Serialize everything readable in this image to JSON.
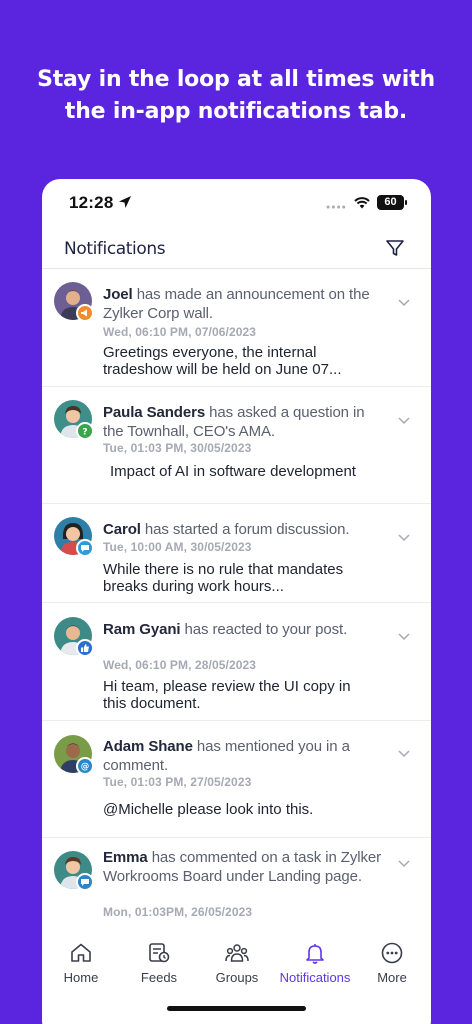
{
  "headline": {
    "line1": "Stay in the loop at all times with",
    "line2": "the in-app notifications tab."
  },
  "status_bar": {
    "time": "12:28",
    "battery": "60"
  },
  "header": {
    "title": "Notifications"
  },
  "notifications": [
    {
      "name": "Joel",
      "action": " has made an announcement on the Zylker Corp wall.",
      "timestamp": "Wed, 06:10 PM, 07/06/2023",
      "message": "Greetings everyone, the internal tradeshow will be held on June 07...",
      "badge_icon": "megaphone-icon",
      "badge_color": "#f08c2c"
    },
    {
      "name": "Paula Sanders",
      "action": " has asked a question in the Townhall, CEO's AMA.",
      "timestamp": "Tue, 01:03 PM, 30/05/2023",
      "message": "Impact of AI in software development",
      "badge_icon": "question-icon",
      "badge_color": "#3aa54a"
    },
    {
      "name": "Carol",
      "action": " has started a forum discussion.",
      "timestamp": "Tue, 10:00 AM, 30/05/2023",
      "message": "While there is no rule that mandates breaks during work hours...",
      "badge_icon": "chat-icon",
      "badge_color": "#2e9bd6"
    },
    {
      "name": "Ram Gyani",
      "action": " has reacted to your post.",
      "timestamp": "Wed, 06:10 PM, 28/05/2023",
      "message": "Hi team, please review the UI copy in this document.",
      "badge_icon": "thumbs-up-icon",
      "badge_color": "#2b6fd1"
    },
    {
      "name": "Adam Shane",
      "action": " has mentioned you in a comment.",
      "timestamp": "Tue, 01:03 PM, 27/05/2023",
      "message": "@Michelle please look into this.",
      "badge_icon": "at-icon",
      "badge_color": "#2b86c8"
    },
    {
      "name": "Emma",
      "action": " has commented on a task in Zylker Workrooms Board under Landing page.",
      "timestamp": "Mon, 01:03PM, 26/05/2023",
      "message": "",
      "badge_icon": "comment-icon",
      "badge_color": "#2b86c8"
    }
  ],
  "tabs": [
    {
      "label": "Home",
      "icon": "home-icon"
    },
    {
      "label": "Feeds",
      "icon": "feeds-icon"
    },
    {
      "label": "Groups",
      "icon": "groups-icon"
    },
    {
      "label": "Notifications",
      "icon": "bell-icon",
      "active": true
    },
    {
      "label": "More",
      "icon": "more-icon"
    }
  ],
  "colors": {
    "background": "#5b25df",
    "accent": "#6136e3"
  }
}
